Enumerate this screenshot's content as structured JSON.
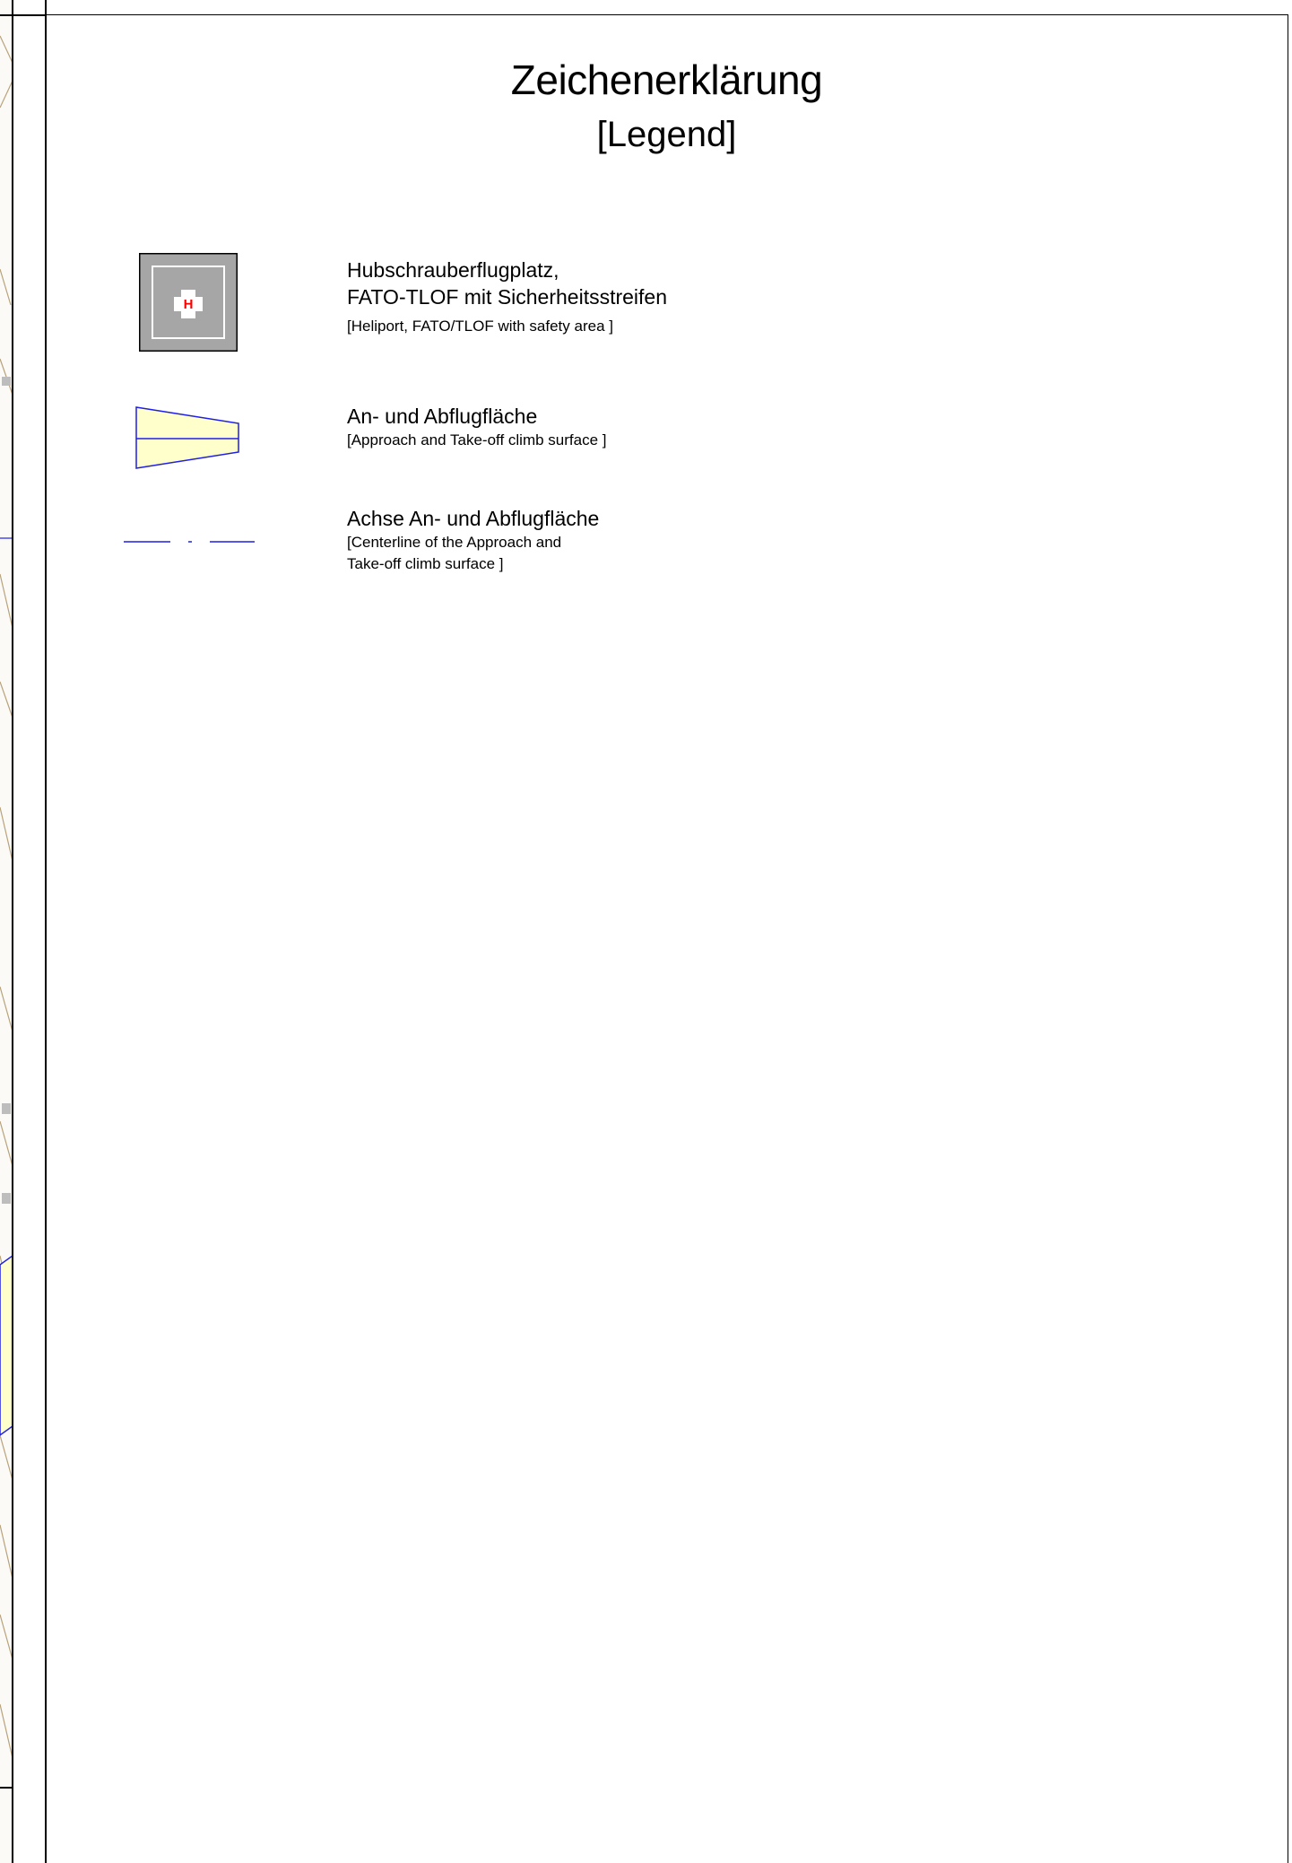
{
  "legend": {
    "title": "Zeichenerklärung",
    "subtitle": "[Legend]",
    "items": [
      {
        "icon": "heliport-icon",
        "label_de_line1": "Hubschrauberflugplatz,",
        "label_de_line2": "FATO-TLOF mit Sicherheitsstreifen",
        "label_en": "[Heliport, FATO/TLOF with safety area ]",
        "marker": "H"
      },
      {
        "icon": "approach-surface-icon",
        "label_de": "An- und Abflugfläche",
        "label_en": "[Approach and Take-off climb surface ]"
      },
      {
        "icon": "centerline-icon",
        "label_de": "Achse An- und Abflugfläche",
        "label_en_line1": "[Centerline of the Approach and",
        "label_en_line2": "Take-off climb surface ]"
      }
    ]
  },
  "colors": {
    "approach_fill": "#ffffcc",
    "approach_stroke": "#1f1fe6",
    "heliport_outer": "#a6a6a6",
    "heliport_marker": "#ff0000"
  }
}
